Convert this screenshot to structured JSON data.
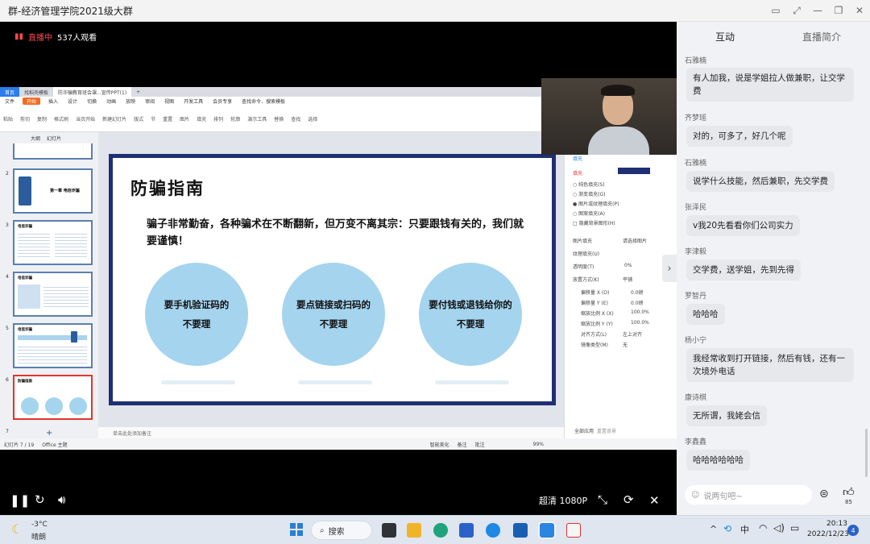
{
  "window": {
    "title": "群-经济管理学院2021级大群"
  },
  "live": {
    "status": "直播中",
    "viewers": "537人观看"
  },
  "ppt": {
    "tabs": [
      "首页",
      "找稻壳模板",
      "防诈骗教育班会课...宣传PPT(1)"
    ],
    "menu": [
      "文件",
      "开始",
      "插入",
      "设计",
      "切换",
      "动画",
      "放映",
      "审阅",
      "视图",
      "开发工具",
      "会员专享",
      "查找命令、搜索模板"
    ],
    "tools": [
      "粘贴",
      "剪切",
      "复制",
      "格式刷",
      "当页开始",
      "新建幻灯片",
      "版式",
      "节",
      "重置",
      "图片",
      "填充",
      "排列",
      "轮廓",
      "演示工具",
      "替换",
      "查找",
      "选择"
    ],
    "thumb_tabs": [
      "大纲",
      "幻灯片"
    ],
    "thumb_nums": [
      "2",
      "3",
      "4",
      "5",
      "6",
      "7"
    ],
    "thumb2_text": "第一章 电信诈骗",
    "thumb_titles": [
      "电信诈骗",
      "电信诈骗",
      "电信诈骗",
      "防骗指南"
    ],
    "notes": "单击此处添加备注",
    "status_left": "幻灯片 7 / 19",
    "status_theme": "Office 主题",
    "status_right": [
      "智能美化",
      "备注",
      "批注"
    ],
    "zoom": "99%",
    "right_panel": {
      "header": "填充",
      "section": "填充",
      "options": [
        "纯色填充(S)",
        "渐变填充(G)",
        "图片或纹理填充(P)",
        "图案填充(A)",
        "隐藏背景图形(H)"
      ],
      "props": [
        "图片填充",
        "纹理填充(U)",
        "透明度(T)",
        "放置方式(K)",
        "偏移量 X (O)",
        "偏移量 Y (E)",
        "缩放比例 X (X)",
        "缩放比例 Y (Y)",
        "对齐方式(L)",
        "镜像类型(M)"
      ],
      "values": [
        "请选择图片",
        "",
        "0%",
        "平铺",
        "0.0磅",
        "0.0磅",
        "100.0%",
        "100.0%",
        "左上对齐",
        "无"
      ],
      "footer": [
        "全部应用",
        "重置背景"
      ]
    }
  },
  "slide": {
    "title": "防骗指南",
    "body": "骗子非常勤奋，各种骗术在不断翻新，但万变不离其宗：只要跟钱有关的，我们就要谨慎！",
    "circles": [
      {
        "line1": "要手机验证码的",
        "line2": "不要理"
      },
      {
        "line1": "要点链接或扫码的",
        "line2": "不要理"
      },
      {
        "line1": "要付钱或退钱给你的",
        "line2": "不要理"
      }
    ]
  },
  "player": {
    "quality": "超清 1080P"
  },
  "chat": {
    "tabs": [
      "互动",
      "直播简介"
    ],
    "messages": [
      {
        "user": "石雅楠",
        "text": "有人加我，说是学姐拉人做兼职，让交学费"
      },
      {
        "user": "齐梦瑶",
        "text": "对的，可多了，好几个呢"
      },
      {
        "user": "石雅楠",
        "text": "说学什么技能，然后兼职，先交学费"
      },
      {
        "user": "张泽民",
        "text": "v我20先看看你们公司实力"
      },
      {
        "user": "李津毅",
        "text": "交学费，送学姐，先到先得"
      },
      {
        "user": "罗智丹",
        "text": "哈哈哈"
      },
      {
        "user": "杨小宁",
        "text": "我经常收到打开链接，然后有钱，还有一次境外电话"
      },
      {
        "user": "康诗棋",
        "text": "无所谓，我姥会信"
      },
      {
        "user": "李鑫鑫",
        "text": "哈哈哈哈哈哈"
      }
    ],
    "input_placeholder": "说两句吧~",
    "like_count": "85"
  },
  "taskbar": {
    "weather_temp": "-3°C",
    "weather_desc": "晴朗",
    "search_label": "搜索",
    "ime": "中",
    "time": "20:13",
    "date": "2022/12/23",
    "notif_count": "4"
  }
}
